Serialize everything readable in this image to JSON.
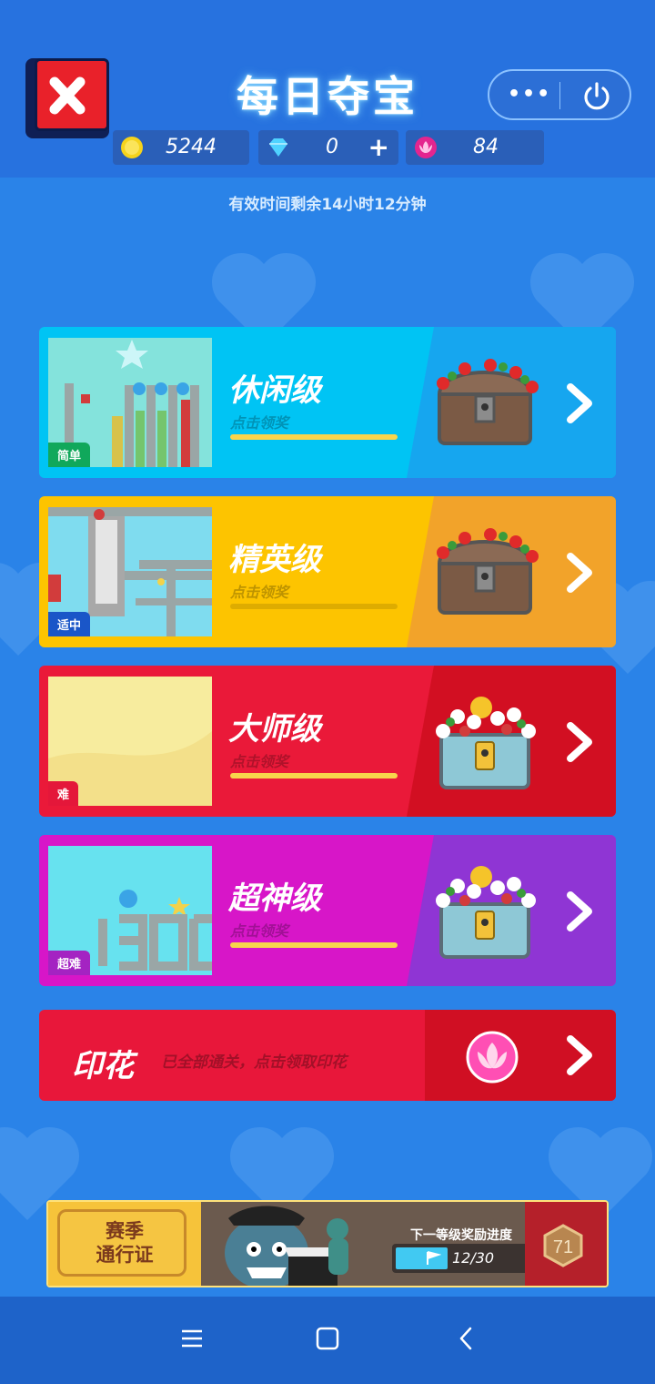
{
  "header": {
    "title": "每日夺宝",
    "more_label": "•••",
    "resources": {
      "coins": "5244",
      "diamonds": "0",
      "diamonds_add_label": "+",
      "lotus": "84"
    },
    "timer_text": "有效时间剩余14小时12分钟"
  },
  "levels": [
    {
      "name": "休闲级",
      "sub": "点击领奖",
      "badge": "简单",
      "progress": 1.0,
      "main_color": "#00c4f4",
      "side_color": "#16a6ef",
      "badge_color": "#10a85b",
      "bar_color": "#f8d54c"
    },
    {
      "name": "精英级",
      "sub": "点击领奖",
      "badge": "适中",
      "progress": 0.0,
      "main_color": "#fdc400",
      "side_color": "#f2a32a",
      "badge_color": "#1a56c8",
      "bar_color": "#f8d54c"
    },
    {
      "name": "大师级",
      "sub": "点击领奖",
      "badge": "难",
      "progress": 1.0,
      "main_color": "#ea1939",
      "side_color": "#d20f22",
      "badge_color": "#e4173a",
      "bar_color": "#f8d54c"
    },
    {
      "name": "超神级",
      "sub": "点击领奖",
      "badge": "超难",
      "progress": 1.0,
      "main_color": "#d716c8",
      "side_color": "#8f35d4",
      "badge_color": "#a423c2",
      "bar_color": "#f8d54c"
    }
  ],
  "stamp": {
    "name": "印花",
    "desc": "已全部通关，点击领取印花"
  },
  "season_pass": {
    "title_line1": "赛季",
    "title_line2": "通行证",
    "next_reward_label": "下一等级奖励进度",
    "progress_text": "12/30",
    "progress": 0.4,
    "level": "71"
  },
  "nav": {
    "menu_icon": "menu-icon",
    "home_icon": "home-icon",
    "back_icon": "back-icon"
  }
}
